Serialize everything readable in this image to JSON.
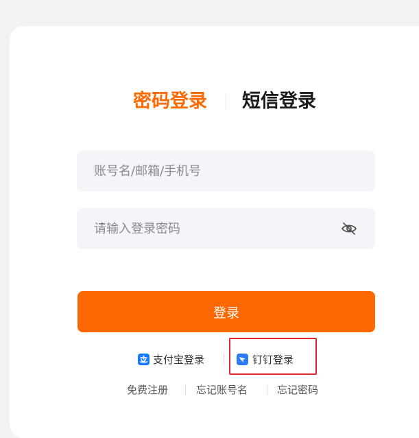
{
  "tabs": {
    "password_login": "密码登录",
    "sms_login": "短信登录",
    "active": "password_login"
  },
  "form": {
    "account_placeholder": "账号名/邮箱/手机号",
    "account_value": "",
    "password_placeholder": "请输入登录密码",
    "password_value": "",
    "password_toggle_icon": "eye-off-icon",
    "submit_label": "登录"
  },
  "third_party": {
    "alipay_label": "支付宝登录",
    "alipay_icon": "alipay-icon",
    "dingtalk_label": "钉钉登录",
    "dingtalk_icon": "dingtalk-icon"
  },
  "footer_links": {
    "register": "免费注册",
    "forgot_account": "忘记账号名",
    "forgot_password": "忘记密码"
  },
  "colors": {
    "accent": "#ff6a00",
    "button": "#ff6800",
    "input_bg": "#f3f5f8",
    "highlight": "#e0262b",
    "alipay_blue": "#1677ff",
    "dingtalk_blue": "#2b7cf6"
  }
}
